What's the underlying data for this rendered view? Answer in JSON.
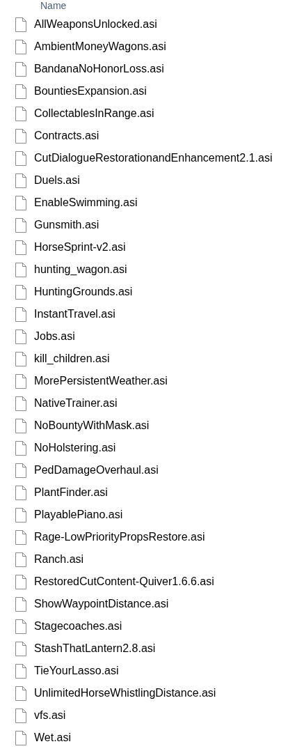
{
  "header": {
    "column_1": "Name"
  },
  "files": [
    {
      "name": "AllWeaponsUnlocked.asi"
    },
    {
      "name": "AmbientMoneyWagons.asi"
    },
    {
      "name": "BandanaNoHonorLoss.asi"
    },
    {
      "name": "BountiesExpansion.asi"
    },
    {
      "name": "CollectablesInRange.asi"
    },
    {
      "name": "Contracts.asi"
    },
    {
      "name": "CutDialogueRestorationandEnhancement2.1.asi"
    },
    {
      "name": "Duels.asi"
    },
    {
      "name": "EnableSwimming.asi"
    },
    {
      "name": "Gunsmith.asi"
    },
    {
      "name": "HorseSprint-v2.asi"
    },
    {
      "name": "hunting_wagon.asi"
    },
    {
      "name": "HuntingGrounds.asi"
    },
    {
      "name": "InstantTravel.asi"
    },
    {
      "name": "Jobs.asi"
    },
    {
      "name": "kill_children.asi"
    },
    {
      "name": "MorePersistentWeather.asi"
    },
    {
      "name": "NativeTrainer.asi"
    },
    {
      "name": "NoBountyWithMask.asi"
    },
    {
      "name": "NoHolstering.asi"
    },
    {
      "name": "PedDamageOverhaul.asi"
    },
    {
      "name": "PlantFinder.asi"
    },
    {
      "name": "PlayablePiano.asi"
    },
    {
      "name": "Rage-LowPriorityPropsRestore.asi"
    },
    {
      "name": "Ranch.asi"
    },
    {
      "name": "RestoredCutContent-Quiver1.6.6.asi"
    },
    {
      "name": "ShowWaypointDistance.asi"
    },
    {
      "name": "Stagecoaches.asi"
    },
    {
      "name": "StashThatLantern2.8.asi"
    },
    {
      "name": "TieYourLasso.asi"
    },
    {
      "name": "UnlimitedHorseWhistlingDistance.asi"
    },
    {
      "name": "vfs.asi"
    },
    {
      "name": "Wet.asi"
    }
  ]
}
